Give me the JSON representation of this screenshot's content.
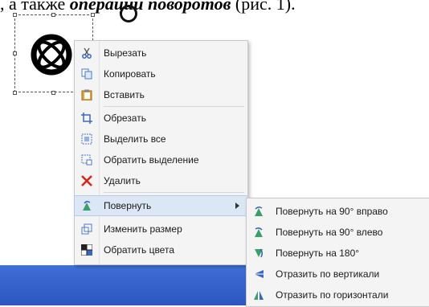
{
  "caption": {
    "prefix": ", а также ",
    "italic": "операций поворотов",
    "suffix": " (рис. 1)."
  },
  "context_menu": {
    "items": [
      {
        "label": "Вырезать",
        "icon": "scissors-icon"
      },
      {
        "label": "Копировать",
        "icon": "copy-icon"
      },
      {
        "label": "Вставить",
        "icon": "paste-icon"
      },
      {
        "label": "Обрезать",
        "icon": "crop-icon"
      },
      {
        "label": "Выделить все",
        "icon": "select-all-icon"
      },
      {
        "label": "Обратить выделение",
        "icon": "invert-selection-icon"
      },
      {
        "label": "Удалить",
        "icon": "delete-icon"
      },
      {
        "label": "Повернуть",
        "icon": "rotate-icon",
        "has_submenu": true,
        "highlighted": true
      },
      {
        "label": "Изменить размер",
        "icon": "resize-icon"
      },
      {
        "label": "Обратить цвета",
        "icon": "invert-colors-icon"
      }
    ]
  },
  "rotate_submenu": {
    "items": [
      {
        "label": "Повернуть на 90° вправо",
        "icon": "rotate-right-icon"
      },
      {
        "label": "Повернуть на 90° влево",
        "icon": "rotate-left-icon"
      },
      {
        "label": "Повернуть на 180°",
        "icon": "rotate-180-icon"
      },
      {
        "label": "Отразить по вертикали",
        "icon": "flip-vertical-icon"
      },
      {
        "label": "Отразить по горизонтали",
        "icon": "flip-horizontal-icon"
      }
    ]
  },
  "colors": {
    "highlight": "#dce7f6",
    "taskbar": "#3f6fd6",
    "delete_icon": "#d9261c"
  }
}
